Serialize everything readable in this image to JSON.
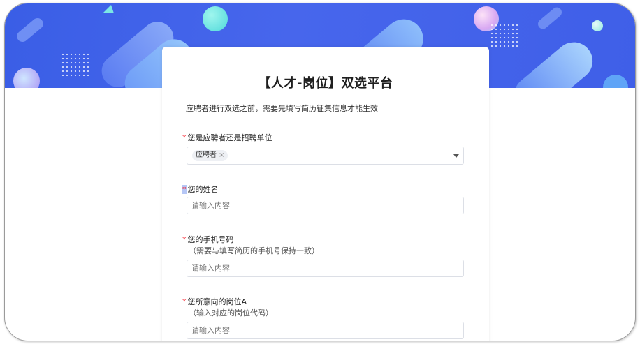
{
  "page": {
    "title": "【人才-岗位】双选平台",
    "description": "应聘者进行双选之前，需要先填写简历征集信息才能生效"
  },
  "form": {
    "required_mark": "*",
    "role": {
      "label": "您是应聘者还是招聘单位",
      "selected_tag": "应聘者",
      "remove_glyph": "×"
    },
    "name": {
      "label": "您的姓名",
      "placeholder": "请输入内容"
    },
    "phone": {
      "label": "您的手机号码",
      "hint": "（需要与填写简历的手机号保持一致）",
      "placeholder": "请输入内容"
    },
    "position_a": {
      "label": "您所意向的岗位A",
      "hint": "（输入对应的岗位代码）",
      "placeholder": "请输入内容"
    }
  },
  "icons": [
    "close-icon",
    "chevron-down-icon"
  ],
  "colors": {
    "banner": "#3f5fe8",
    "required": "#f5222d",
    "border": "#dcdfe6"
  }
}
